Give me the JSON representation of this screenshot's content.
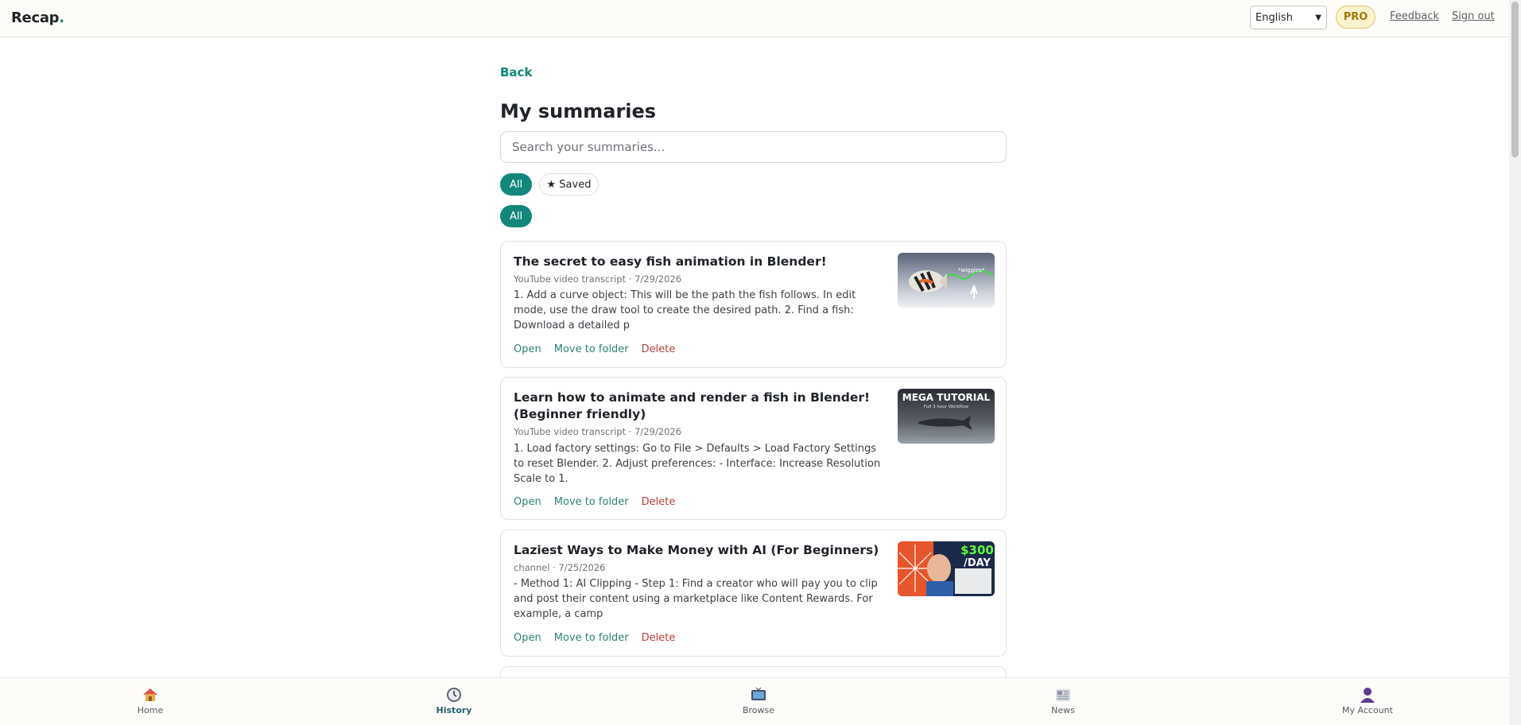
{
  "header": {
    "brand": "Recap",
    "brand_dot": ".",
    "language": "English",
    "pro_badge": "PRO",
    "feedback": "Feedback",
    "sign_out": "Sign out"
  },
  "main": {
    "back": "Back",
    "title": "My summaries",
    "search_placeholder": "Search your summaries...",
    "filters": {
      "all": "All",
      "saved": "★ Saved",
      "all_secondary": "All"
    },
    "cards": [
      {
        "title": "The secret to easy fish animation in Blender!",
        "meta": "YouTube video transcript · 7/29/2026",
        "excerpt": "1. Add a curve object: This will be the path the fish follows. In edit mode, use the draw tool to create the desired path. 2. Find a fish: Download a detailed p",
        "thumb_text": "*wiggles*",
        "open": "Open",
        "move": "Move to folder",
        "delete": "Delete"
      },
      {
        "title": "Learn how to animate and render a fish in Blender! (Beginner friendly)",
        "meta": "YouTube video transcript · 7/29/2026",
        "excerpt": "1. Load factory settings: Go to File > Defaults > Load Factory Settings to reset Blender. 2. Adjust preferences: - Interface: Increase Resolution Scale to 1.",
        "thumb_text": "MEGA TUTORIAL",
        "thumb_subtext": "Full 3-hour Workflow",
        "open": "Open",
        "move": "Move to folder",
        "delete": "Delete"
      },
      {
        "title": "Laziest Ways to Make Money with AI (For Beginners)",
        "meta": "channel · 7/25/2026",
        "excerpt": "- Method 1: AI Clipping - Step 1: Find a creator who will pay you to clip and post their content using a marketplace like Content Rewards. For example, a camp",
        "thumb_text": "$300",
        "thumb_subtext": "/DAY",
        "open": "Open",
        "move": "Move to folder",
        "delete": "Delete"
      }
    ]
  },
  "bottom_nav": {
    "home": "Home",
    "history": "History",
    "browse": "Browse",
    "news": "News",
    "account": "My Account"
  },
  "colors": {
    "accent": "#13877b",
    "pro": "#a47809",
    "delete": "#b3403b"
  }
}
